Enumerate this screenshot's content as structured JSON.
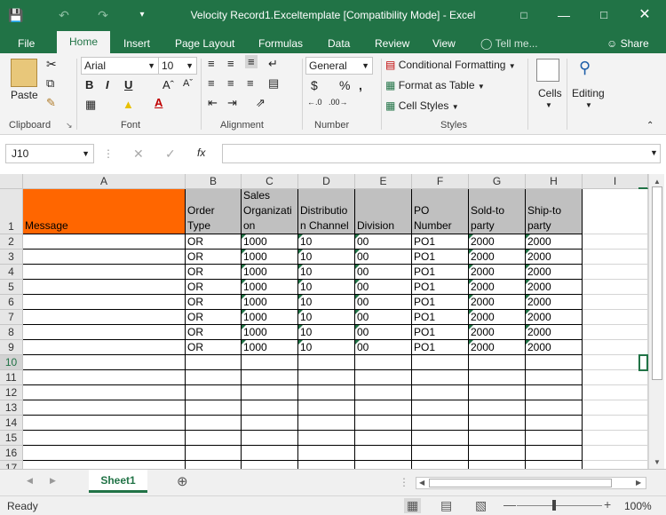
{
  "window": {
    "title": "Velocity Record1.Exceltemplate  [Compatibility Mode] - Excel"
  },
  "tabs": [
    "File",
    "Home",
    "Insert",
    "Page Layout",
    "Formulas",
    "Data",
    "Review",
    "View"
  ],
  "tell_me": "Tell me...",
  "share": "Share",
  "ribbon": {
    "clipboard": {
      "paste": "Paste",
      "label": "Clipboard"
    },
    "font": {
      "name": "Arial",
      "size": "10",
      "label": "Font"
    },
    "alignment": {
      "label": "Alignment"
    },
    "number": {
      "format": "General",
      "label": "Number"
    },
    "styles": {
      "conditional": "Conditional Formatting",
      "format_table": "Format as Table",
      "cell_styles": "Cell Styles",
      "label": "Styles"
    },
    "cells": "Cells",
    "editing": "Editing"
  },
  "formula_bar": {
    "name_box": "J10",
    "fx": "fx",
    "value": ""
  },
  "sheet": {
    "columns": [
      "A",
      "B",
      "C",
      "D",
      "E",
      "F",
      "G",
      "H",
      "I"
    ],
    "rows": [
      "1",
      "2",
      "3",
      "4",
      "5",
      "6",
      "7",
      "8",
      "9",
      "10",
      "11",
      "12",
      "13",
      "14",
      "15",
      "16",
      "17"
    ],
    "headers": [
      "Message",
      "Order Type",
      "Sales Organization",
      "Distribution Channel",
      "Division",
      "PO Number",
      "Sold-to party",
      "Ship-to party"
    ],
    "header_lines": [
      [
        "Message"
      ],
      [
        "Order",
        "Type"
      ],
      [
        "Sales",
        "Organizati",
        "on"
      ],
      [
        "Distributio",
        "n Channel"
      ],
      [
        "Division"
      ],
      [
        "PO",
        "Number"
      ],
      [
        "Sold-to",
        "party"
      ],
      [
        "Ship-to",
        "party"
      ]
    ],
    "data_rows": [
      [
        "",
        "OR",
        "1000",
        "10",
        "00",
        "PO1",
        "2000",
        "2000"
      ],
      [
        "",
        "OR",
        "1000",
        "10",
        "00",
        "PO1",
        "2000",
        "2000"
      ],
      [
        "",
        "OR",
        "1000",
        "10",
        "00",
        "PO1",
        "2000",
        "2000"
      ],
      [
        "",
        "OR",
        "1000",
        "10",
        "00",
        "PO1",
        "2000",
        "2000"
      ],
      [
        "",
        "OR",
        "1000",
        "10",
        "00",
        "PO1",
        "2000",
        "2000"
      ],
      [
        "",
        "OR",
        "1000",
        "10",
        "00",
        "PO1",
        "2000",
        "2000"
      ],
      [
        "",
        "OR",
        "1000",
        "10",
        "00",
        "PO1",
        "2000",
        "2000"
      ],
      [
        "",
        "OR",
        "1000",
        "10",
        "00",
        "PO1",
        "2000",
        "2000"
      ]
    ]
  },
  "sheet_tab": "Sheet1",
  "status": {
    "ready": "Ready",
    "zoom": "100%"
  },
  "colors": {
    "excel_green": "#217346",
    "message_header": "#ff6600",
    "header_gray": "#c0c0c0"
  }
}
